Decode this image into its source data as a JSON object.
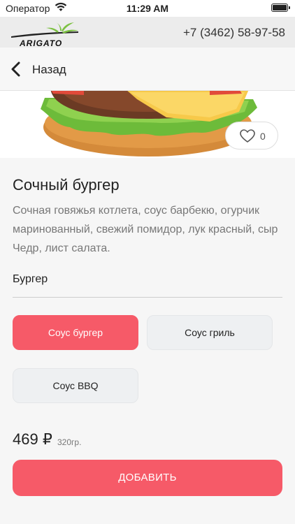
{
  "status_bar": {
    "carrier": "Оператор",
    "time": "11:29 AM"
  },
  "brand": {
    "logo_text": "ARIGATO",
    "phone": "+7 (3462) 58-97-58"
  },
  "nav": {
    "back_label": "Назад"
  },
  "product": {
    "image": "burger-photo",
    "likes": "0",
    "title": "Сочный бургер",
    "description": "Сочная говяжья котлета, соус барбекю, огурчик маринованный, свежий помидор, лук красный, сыр Чедр, лист салата.",
    "group_label": "Бургер",
    "options": [
      {
        "label": "Соус бургер",
        "selected": true
      },
      {
        "label": "Соус гриль",
        "selected": false
      },
      {
        "label": "Соус BBQ",
        "selected": false
      }
    ],
    "price": "469 ₽",
    "weight": "320гр.",
    "add_label": "ДОБАВИТЬ"
  },
  "colors": {
    "accent": "#f65a68",
    "chip_bg": "#eef0f2",
    "brand_bar_bg": "#ececec"
  }
}
